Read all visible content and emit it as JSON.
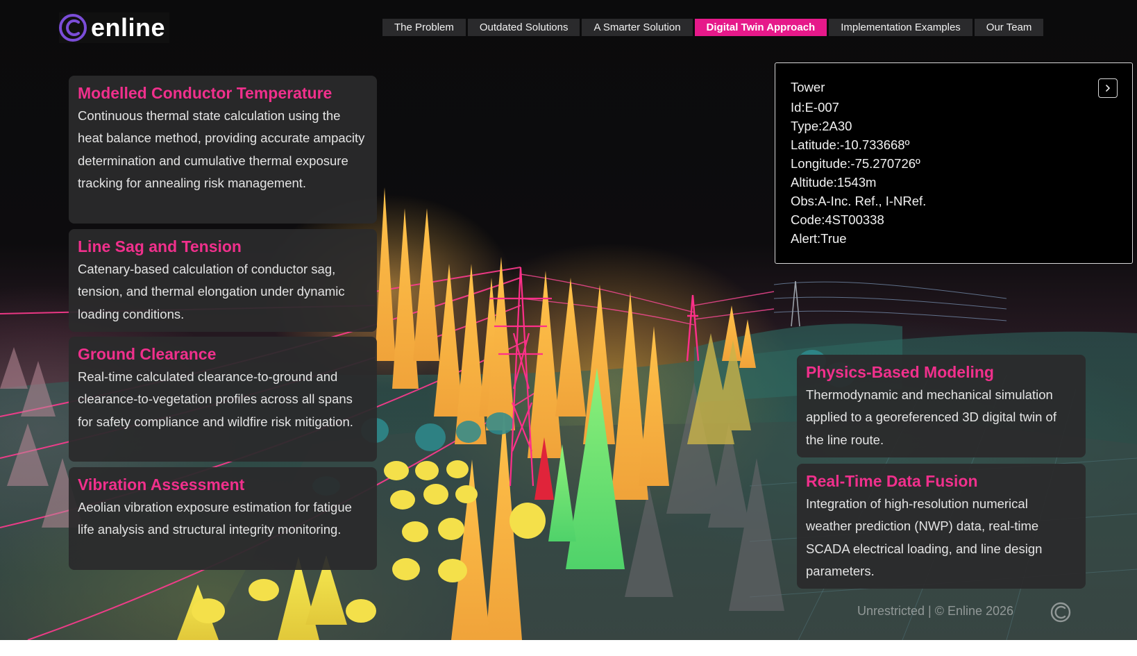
{
  "brand": {
    "name": "enline"
  },
  "nav": {
    "tabs": [
      {
        "label": "The Problem",
        "active": false
      },
      {
        "label": "Outdated Solutions",
        "active": false
      },
      {
        "label": "A Smarter Solution",
        "active": false
      },
      {
        "label": "Digital Twin Approach",
        "active": true
      },
      {
        "label": "Implementation Examples",
        "active": false
      },
      {
        "label": "Our Team",
        "active": false
      }
    ]
  },
  "left_cards": [
    {
      "title": "Modelled Conductor Temperature",
      "body": "Continuous thermal state calculation using the heat balance method, providing accurate ampacity determination and cumulative thermal exposure tracking for annealing risk management."
    },
    {
      "title": "Line Sag and Tension",
      "body": "Catenary-based calculation of conductor sag, tension, and thermal elongation under dynamic loading conditions."
    },
    {
      "title": "Ground Clearance",
      "body": "Real-time calculated clearance-to-ground and clearance-to-vegetation profiles across all spans for safety compliance and wildfire risk mitigation."
    },
    {
      "title": "Vibration Assessment",
      "body": "Aeolian vibration exposure estimation for fatigue life analysis and structural integrity monitoring."
    }
  ],
  "right_cards": [
    {
      "title": "Physics-Based Modeling",
      "body": "Thermodynamic and mechanical simulation applied to a georeferenced 3D digital twin of the line route."
    },
    {
      "title": "Real-Time Data Fusion",
      "body": "Integration of high-resolution numerical weather prediction (NWP) data, real-time SCADA electrical loading, and line design parameters."
    }
  ],
  "tower_info": {
    "heading": "Tower",
    "lines": [
      "Id:E-007",
      "Type:2A30",
      "Latitude:-10.733668º",
      "Longitude:-75.270726º",
      "Altitude:1543m",
      "Obs:A-Inc. Ref., I-NRef.",
      "Code:4ST00338",
      "Alert:True"
    ],
    "expand_icon": "chevron-right-icon"
  },
  "footer": {
    "text": "Unrestricted | © Enline 2026"
  },
  "colors": {
    "accent": "#e6198a",
    "title_pink": "#f0308c",
    "card_bg": "#2a2a2c"
  }
}
